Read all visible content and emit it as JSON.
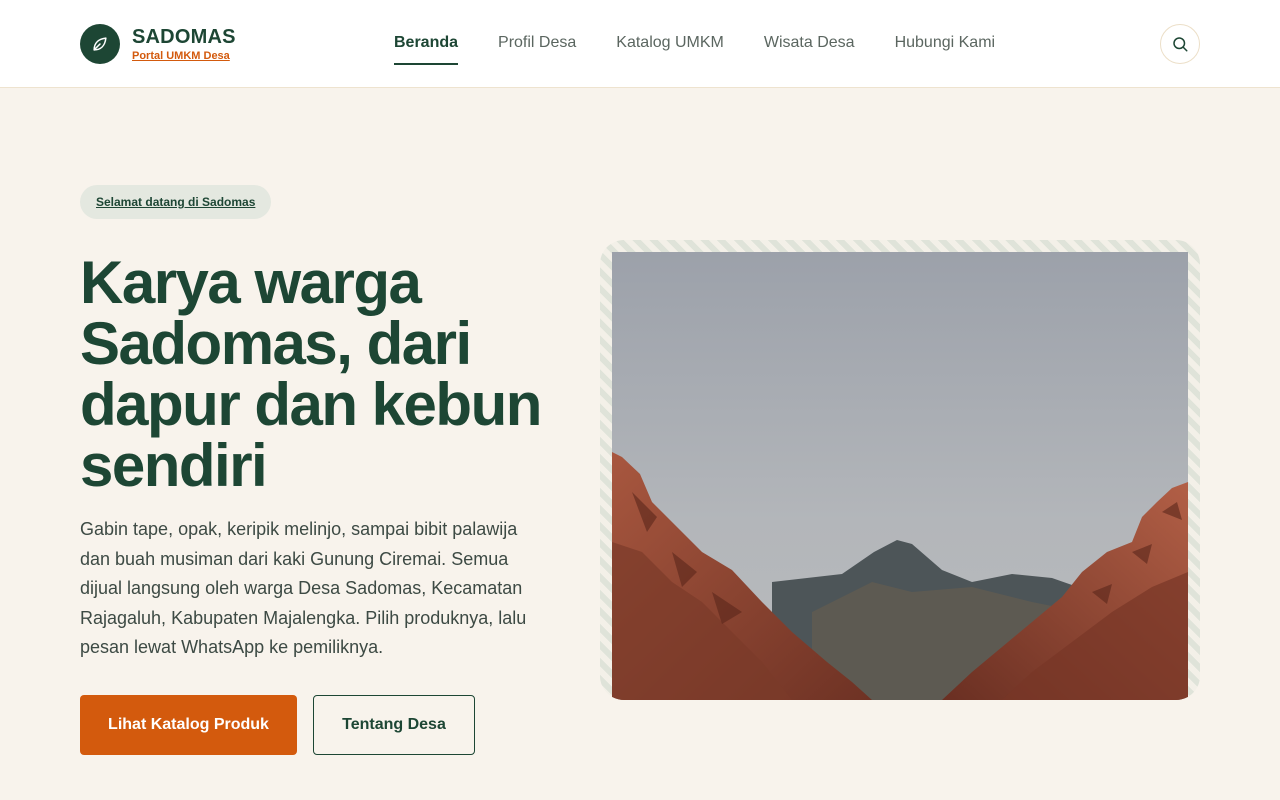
{
  "header": {
    "brand_name": "SADOMAS",
    "brand_sub": "Portal UMKM Desa",
    "nav": [
      {
        "label": "Beranda",
        "active": true
      },
      {
        "label": "Profil Desa",
        "active": false
      },
      {
        "label": "Katalog UMKM",
        "active": false
      },
      {
        "label": "Wisata Desa",
        "active": false
      },
      {
        "label": "Hubungi Kami",
        "active": false
      }
    ],
    "logo_icon": "leaf-icon",
    "search_icon": "search-icon"
  },
  "hero": {
    "badge": "Selamat datang di Sadomas",
    "headline": "Karya warga Sadomas, dari dapur dan kebun sendiri",
    "description": "Gabin tape, opak, keripik melinjo, sampai bibit palawija dan buah musiman dari kaki Gunung Ciremai. Semua dijual langsung oleh warga Desa Sadomas, Kecamatan Rajagaluh, Kabupaten Majalengka. Pilih produknya, lalu pesan lewat WhatsApp ke pemiliknya.",
    "primary_button": "Lihat Katalog Produk",
    "secondary_button": "Tentang Desa"
  },
  "colors": {
    "brand_green": "#1d4634",
    "accent_orange": "#d35a0d",
    "page_bg": "#f8f3ec"
  }
}
